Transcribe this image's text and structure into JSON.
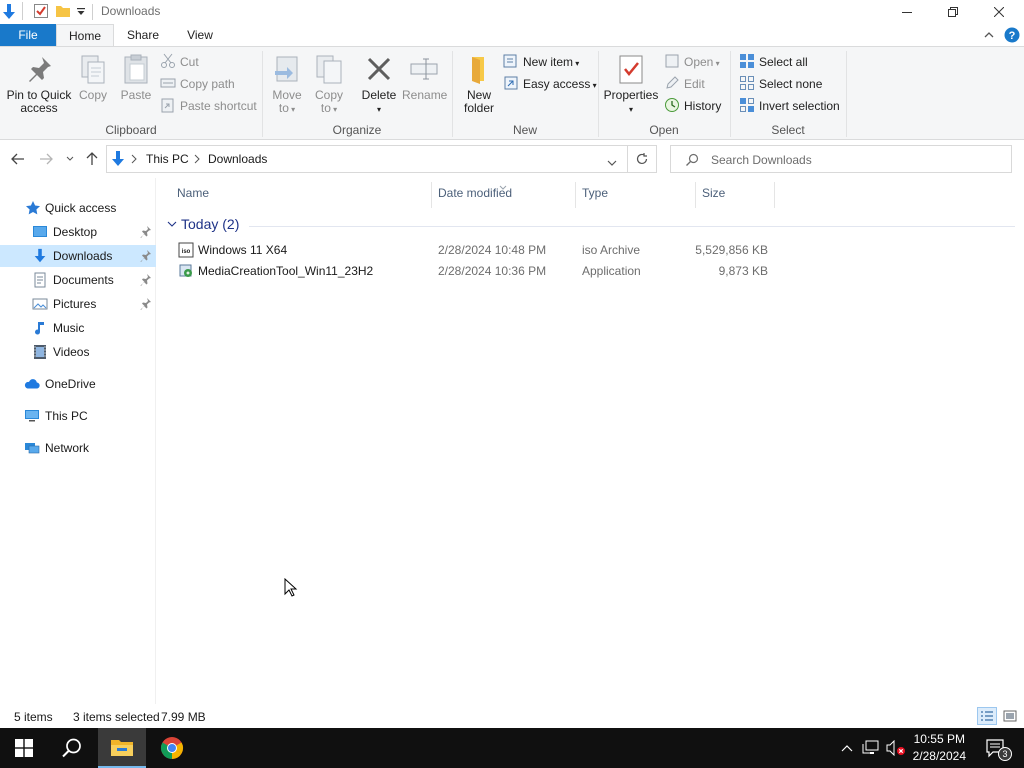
{
  "window": {
    "title": "Downloads"
  },
  "ribbon_tabs": {
    "file": "File",
    "home": "Home",
    "share": "Share",
    "view": "View"
  },
  "ribbon": {
    "clipboard": {
      "group_label": "Clipboard",
      "pin_to_quick_access_line1": "Pin to Quick",
      "pin_to_quick_access_line2": "access",
      "copy": "Copy",
      "paste": "Paste",
      "cut": "Cut",
      "copy_path": "Copy path",
      "paste_shortcut": "Paste shortcut"
    },
    "organize": {
      "group_label": "Organize",
      "move_to_line1": "Move",
      "move_to_line2": "to",
      "copy_to_line1": "Copy",
      "copy_to_line2": "to",
      "delete": "Delete",
      "rename": "Rename"
    },
    "new": {
      "group_label": "New",
      "new_folder_line1": "New",
      "new_folder_line2": "folder",
      "new_item": "New item",
      "easy_access": "Easy access"
    },
    "open": {
      "group_label": "Open",
      "properties": "Properties",
      "open": "Open",
      "edit": "Edit",
      "history": "History"
    },
    "select": {
      "group_label": "Select",
      "select_all": "Select all",
      "select_none": "Select none",
      "invert_selection": "Invert selection"
    }
  },
  "address_bar": {
    "path": [
      "This PC",
      "Downloads"
    ],
    "search_placeholder": "Search Downloads"
  },
  "nav_pane": {
    "quick_access": "Quick access",
    "items": [
      {
        "label": "Desktop",
        "pinned": true
      },
      {
        "label": "Downloads",
        "pinned": true,
        "selected": true
      },
      {
        "label": "Documents",
        "pinned": true
      },
      {
        "label": "Pictures",
        "pinned": true
      },
      {
        "label": "Music",
        "pinned": false
      },
      {
        "label": "Videos",
        "pinned": false
      }
    ],
    "onedrive": "OneDrive",
    "this_pc": "This PC",
    "network": "Network"
  },
  "file_list": {
    "columns": {
      "name": "Name",
      "date_modified": "Date modified",
      "type": "Type",
      "size": "Size"
    },
    "group_header": "Today (2)",
    "rows": [
      {
        "name": "Windows 11 X64",
        "date": "2/28/2024 10:48 PM",
        "type": "iso Archive",
        "size": "5,529,856 KB"
      },
      {
        "name": "MediaCreationTool_Win11_23H2",
        "date": "2/28/2024 10:36 PM",
        "type": "Application",
        "size": "9,873 KB"
      }
    ]
  },
  "status_bar": {
    "item_count": "5 items",
    "selection": "3 items selected",
    "selection_size": "7.99 MB"
  },
  "taskbar": {
    "time": "10:55 PM",
    "date": "2/28/2024",
    "notification_count": "3"
  },
  "colors": {
    "accent": "#1979ca",
    "selection": "#cce8ff",
    "taskbar": "#101010"
  }
}
